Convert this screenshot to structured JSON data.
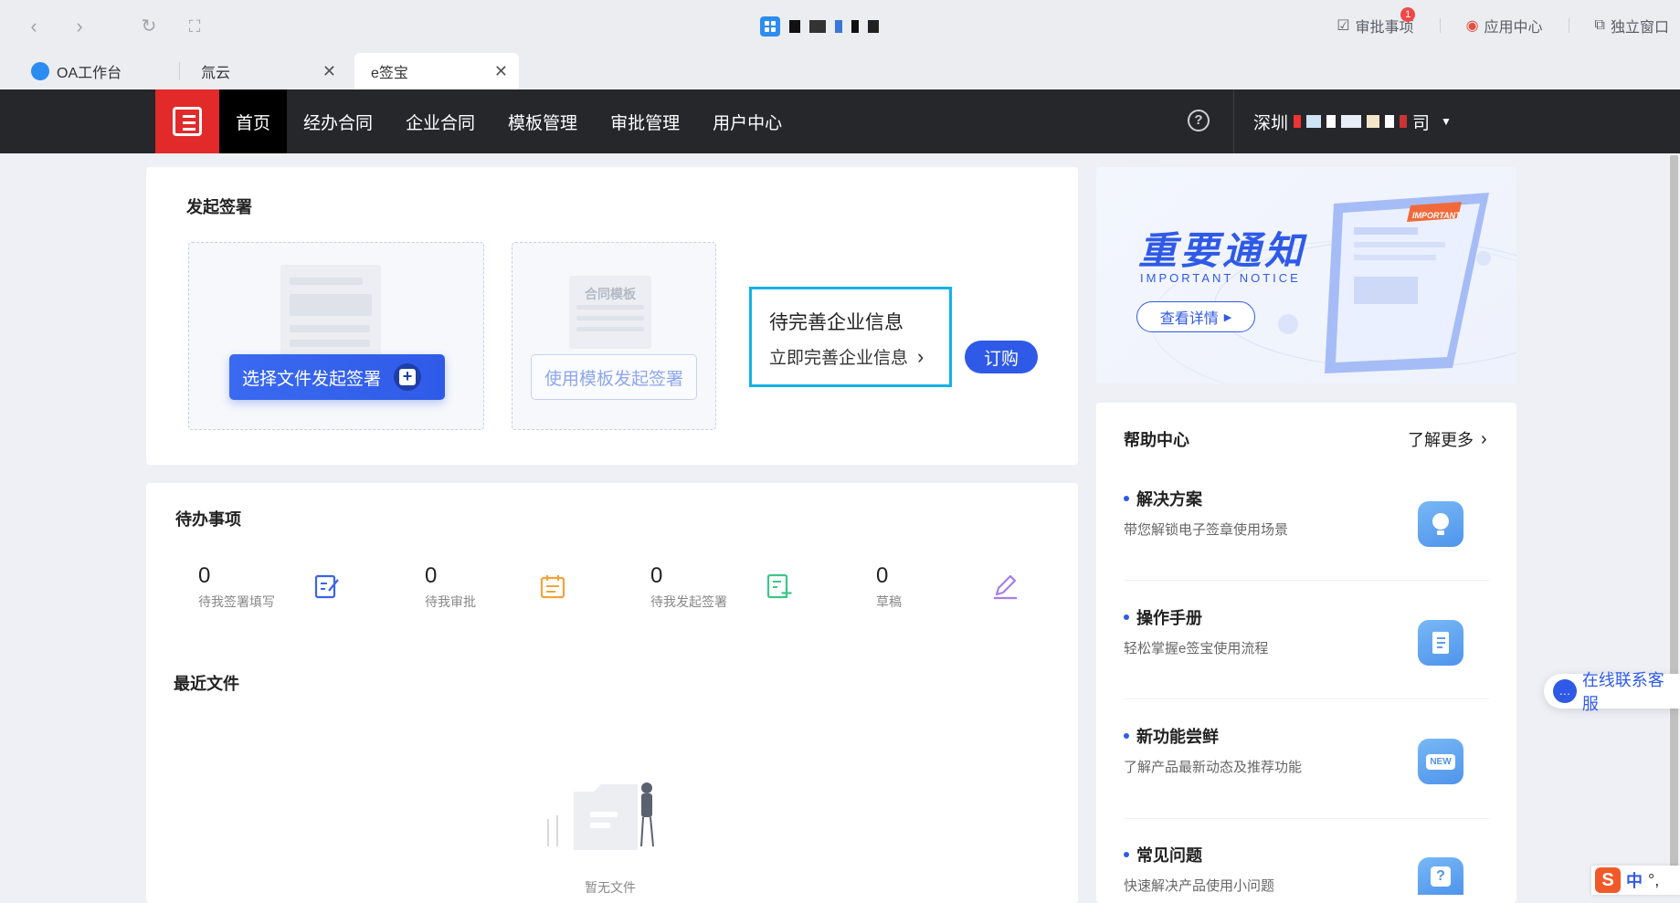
{
  "browser": {
    "back_icon": "chevron-left-icon",
    "forward_icon": "chevron-right-icon",
    "reload_icon": "reload-icon",
    "fullscreen_icon": "fullscreen-icon",
    "tools": {
      "approval_label": "审批事项",
      "approval_badge": "1",
      "app_center_label": "应用中心",
      "standalone_label": "独立窗口"
    },
    "tabs": [
      {
        "label": "OA工作台"
      },
      {
        "label": "氚云"
      },
      {
        "label": "e签宝"
      }
    ]
  },
  "header": {
    "menu": [
      "首页",
      "经办合同",
      "企业合同",
      "模板管理",
      "审批管理",
      "用户中心"
    ],
    "company_prefix": "深圳",
    "company_suffix": "司"
  },
  "initiate": {
    "title": "发起签署",
    "file_button": "选择文件发起签署",
    "template_tag": "合同模板",
    "template_button": "使用模板发起签署",
    "notice_title": "待完善企业信息",
    "notice_link": "立即完善企业信息",
    "subscribe_button": "订购"
  },
  "todo": {
    "title": "待办事项",
    "stats": [
      {
        "value": "0",
        "label": "待我签署填写"
      },
      {
        "value": "0",
        "label": "待我审批"
      },
      {
        "value": "0",
        "label": "待我发起签署"
      },
      {
        "value": "0",
        "label": "草稿"
      }
    ],
    "recent_title": "最近文件",
    "empty_text": "暂无文件"
  },
  "banner": {
    "title": "重要通知",
    "subtitle": "IMPORTANT NOTICE",
    "button": "查看详情",
    "tag": "IMPORTANT"
  },
  "help": {
    "title": "帮助中心",
    "more": "了解更多",
    "items": [
      {
        "title": "解决方案",
        "desc": "带您解锁电子签章使用场景",
        "icon": "lightbulb-icon"
      },
      {
        "title": "操作手册",
        "desc": "轻松掌握e签宝使用流程",
        "icon": "manual-icon"
      },
      {
        "title": "新功能尝鲜",
        "desc": "了解产品最新动态及推荐功能",
        "icon": "new-badge-icon",
        "icon_text": "NEW"
      },
      {
        "title": "常见问题",
        "desc": "快速解决产品使用小问题",
        "icon": "question-icon",
        "icon_text": "?"
      }
    ]
  },
  "service": {
    "label": "在线联系客服"
  },
  "ime": {
    "mode": "中",
    "punct": "°,"
  },
  "colors": {
    "primary": "#2f5ae8",
    "header_bg": "#25272b",
    "logo_red": "#e22a2a",
    "highlight": "#13b1e6"
  }
}
